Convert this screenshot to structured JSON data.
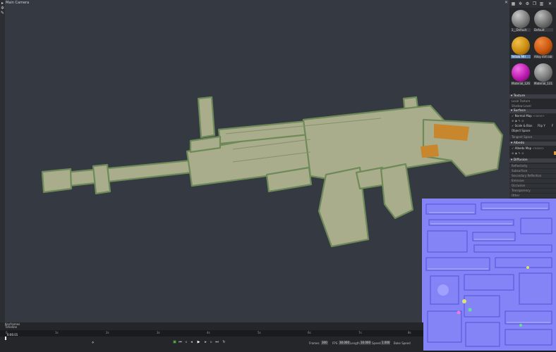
{
  "viewport": {
    "title": "Main Camera",
    "tools": [
      "select-arrow-icon",
      "gear-icon",
      "brush-icon"
    ],
    "close_glyph": "✕"
  },
  "panel": {
    "toolbar_icons": [
      "materials-grid-icon",
      "gear-icon",
      "settings-icon",
      "duplicate-icon",
      "trash-icon",
      "close-icon"
    ],
    "materials": [
      {
        "label": "1__Default",
        "color": "#8a8a8a",
        "selected": false
      },
      {
        "label": "Default",
        "color": "#7c7c7c",
        "selected": false
      },
      {
        "label": "Yellow Mtl",
        "color": "#d2920f",
        "selected": true
      },
      {
        "label": "Alloy dirt lab (1)",
        "color": "#cf5d12",
        "selected": false
      },
      {
        "label": "Material_126",
        "color": "#c41ab8",
        "selected": false
      },
      {
        "label": "Material_131",
        "color": "#7f7f7f",
        "selected": false
      }
    ],
    "sections": {
      "texture_header": "Texture",
      "texture_row_a": "Local Texture",
      "texture_row_b": "Shadow Level",
      "surface_header": "Surface",
      "normal_map": "Normal Map",
      "normal_map_tag": "<none>",
      "scale_bias": "Scale & Bias",
      "flip_y": "Flip Y",
      "flip_x": "F",
      "object_space": "Object Space",
      "tangent_space": "Tangent Space",
      "albedo_header": "Albedo",
      "albedo_map": "Albedo Map",
      "albedo_map_tag": "<none>",
      "diffusion_header": "Diffusion",
      "diffusion_rows": [
        "Reflectivity",
        "Subsurface",
        "Secondary Reflection",
        "Emissive",
        "Occlusion",
        "Transparency",
        "Other"
      ]
    }
  },
  "timeline": {
    "tab_top": "Keyframes",
    "tab_bottom": "Timeline",
    "ticks": [
      "0",
      "1s",
      "2s",
      "3s",
      "4s",
      "5s",
      "6s",
      "7s",
      "8s"
    ],
    "frame_readout": "0:00.01",
    "keyframe_icon": "key-icon",
    "transport_icons": [
      "record-icon",
      "skip-start-icon",
      "step-back-icon",
      "rewind-icon",
      "play-icon",
      "fast-forward-icon",
      "step-forward-icon",
      "skip-end-icon",
      "loop-icon"
    ],
    "fields": {
      "frames_label": "Frames",
      "frames": "300",
      "fps_label": "FPS",
      "fps": "30.000",
      "length_label": "Length",
      "length": "10.000",
      "speed_label": "Speed",
      "speed": "1.000",
      "bake_label": "Bake Speed"
    }
  }
}
